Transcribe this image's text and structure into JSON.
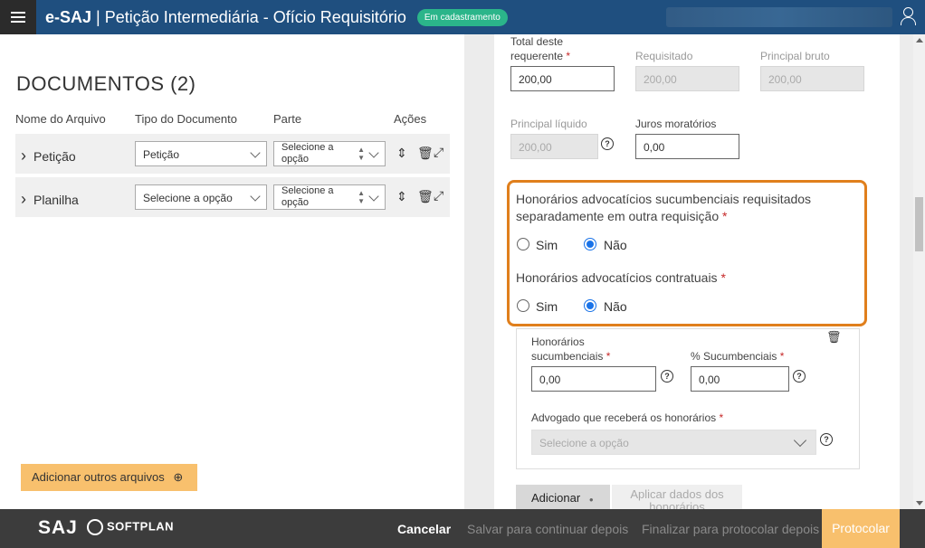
{
  "header": {
    "brand": "e-SAJ",
    "title": " | Petição Intermediária - Ofício Requisitório",
    "status": "Em cadastramento"
  },
  "documents": {
    "title": "DOCUMENTOS (2)",
    "columns": [
      "Nome do Arquivo",
      "Tipo do Documento",
      "Parte",
      "Ações"
    ],
    "rows": [
      {
        "name": "Petição",
        "type": "Petição",
        "part": "Selecione a opção"
      },
      {
        "name": "Planilha",
        "type": "Selecione a opção",
        "part": "Selecione a opção"
      }
    ],
    "add_files": "Adicionar outros arquivos"
  },
  "form": {
    "total_label": "Total deste requerente",
    "total_value": "200,00",
    "requisitado_label": "Requisitado",
    "requisitado_value": "200,00",
    "principal_bruto_label": "Principal bruto",
    "principal_bruto_value": "200,00",
    "principal_liquido_label": "Principal líquido",
    "principal_liquido_value": "200,00",
    "juros_label": "Juros moratórios",
    "juros_value": "0,00",
    "q1": "Honorários advocatícios sucumbenciais requisitados separadamente em outra requisição",
    "q2": "Honorários advocatícios contratuais",
    "opt_sim": "Sim",
    "opt_nao": "Não",
    "q1_selected": "Não",
    "q2_selected": "Não",
    "hon_suc_label": "Honorários sucumbenciais",
    "hon_suc_value": "0,00",
    "pct_suc_label": "% Sucumbenciais",
    "pct_suc_value": "0,00",
    "advogado_label": "Advogado que receberá os honorários",
    "advogado_placeholder": "Selecione a opção",
    "btn_add": "Adicionar",
    "btn_apply": "Aplicar dados dos honorários"
  },
  "footer": {
    "logo_saj": "SAJ",
    "logo_softplan": "SOFTPLAN",
    "cancel": "Cancelar",
    "save_continue": "Salvar para continuar depois",
    "finish_later": "Finalizar para protocolar depois",
    "protocol": "Protocolar"
  },
  "colors": {
    "header": "#1f4f7f",
    "badge": "#2bb58a",
    "highlight": "#e07f1c",
    "accent": "#f8c06d",
    "footer": "#3c3c3c"
  }
}
